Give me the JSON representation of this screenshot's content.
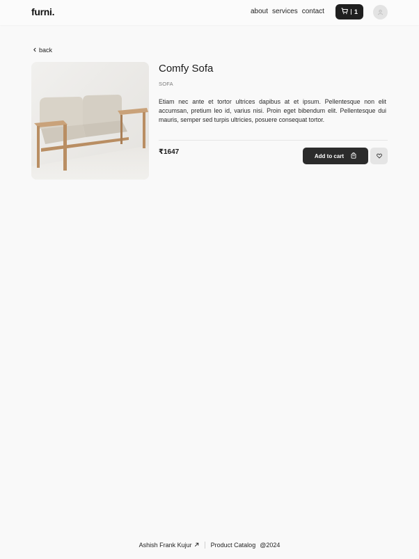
{
  "header": {
    "logo": "furni.",
    "nav": [
      {
        "label": "about"
      },
      {
        "label": "services"
      },
      {
        "label": "contact"
      }
    ],
    "cart": {
      "count": "1",
      "separator": "|"
    }
  },
  "back_label": "back",
  "product": {
    "title": "Comfy Sofa",
    "category": "SOFA",
    "description": "Etiam nec ante et tortor ultrices dapibus at et ipsum. Pellentesque non elit accumsan, pretium leo id, varius nisi. Proin eget bibendum elit. Pellentesque dui mauris, semper sed turpis ultricies, posuere consequat tortor.",
    "price": "₹1647",
    "add_to_cart_label": "Add to cart"
  },
  "footer": {
    "author": "Ashish Frank Kujur",
    "catalog": "Product Catalog",
    "year": "@2024"
  },
  "colors": {
    "background": "#f9f9f9",
    "dark": "#2b2b2b",
    "muted": "#e5e5e5"
  }
}
